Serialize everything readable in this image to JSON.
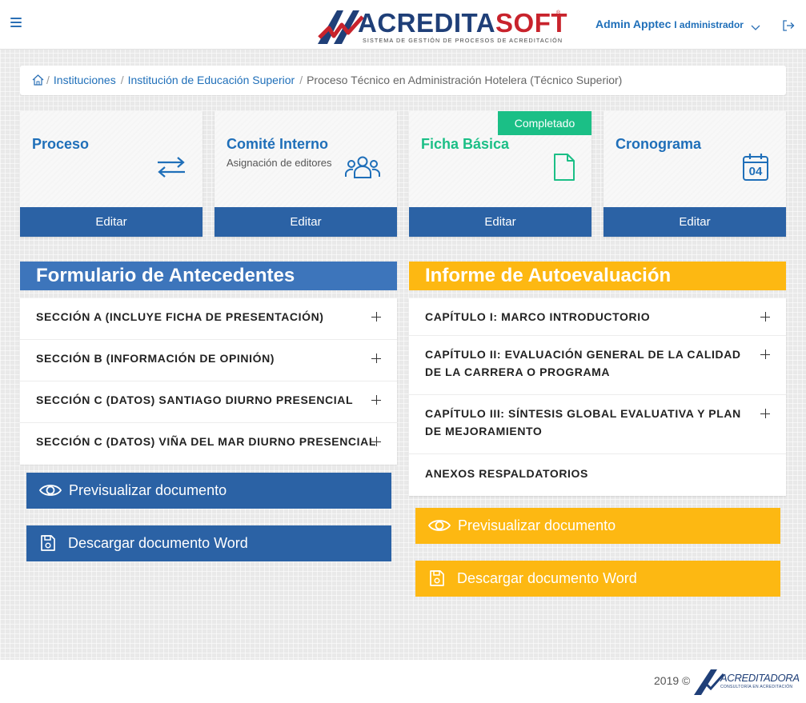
{
  "header": {
    "brand_part1": "ACREDITA",
    "brand_part2": "SOFT",
    "brand_reg": "®",
    "brand_tagline": "Sistema de gestión de procesos de acreditación",
    "user_name": "Admin Apptec",
    "user_role": "I administrador"
  },
  "breadcrumb": {
    "items": [
      "Instituciones",
      "Institución de Educación Superior"
    ],
    "current": "Proceso Técnico en Administración Hotelera (Técnico Superior)",
    "separator": "/"
  },
  "cards": [
    {
      "title": "Proceso",
      "subtitle": "",
      "button": "Editar",
      "icon": "swap-arrows-icon"
    },
    {
      "title": "Comité Interno",
      "subtitle": "Asignación de editores",
      "button": "Editar",
      "icon": "group-icon"
    },
    {
      "title": "Ficha Básica",
      "subtitle": "",
      "button": "Editar",
      "icon": "document-icon",
      "badge": "Completado"
    },
    {
      "title": "Cronograma",
      "subtitle": "",
      "button": "Editar",
      "icon": "calendar-icon",
      "calendar_day": "04"
    }
  ],
  "left_panel": {
    "title": "Formulario de Antecedentes",
    "items": [
      "SECCIÓN A (INCLUYE FICHA DE PRESENTACIÓN)",
      "SECCIÓN B (INFORMACIÓN DE OPINIÓN)",
      "SECCIÓN C (DATOS) SANTIAGO DIURNO PRESENCIAL",
      "SECCIÓN C (DATOS) VIÑA DEL MAR DIURNO PRESENCIAL"
    ],
    "preview_label": "Previsualizar documento",
    "download_label": "Descargar documento Word"
  },
  "right_panel": {
    "title": "Informe de Autoevaluación",
    "items": [
      "CAPÍTULO I: MARCO INTRODUCTORIO",
      "CAPÍTULO II: EVALUACIÓN GENERAL DE LA CALIDAD DE LA CARRERA O PROGRAMA",
      "CAPÍTULO III: SÍNTESIS GLOBAL EVALUATIVA Y PLAN DE MEJORAMIENTO",
      "ANEXOS RESPALDATORIOS"
    ],
    "preview_label": "Previsualizar documento",
    "download_label": "Descargar documento Word"
  },
  "footer": {
    "copyright": "2019 ©",
    "logo_text": "ACREDITADORA",
    "logo_sub": "Consultoría en Acreditación"
  },
  "colors": {
    "primary_blue": "#2b62a5",
    "link_blue": "#1f6fb9",
    "panel_blue": "#3d75bb",
    "yellow": "#fdb812",
    "green": "#1bbf86",
    "brand_navy": "#1f3f78",
    "brand_red": "#c8232c"
  }
}
